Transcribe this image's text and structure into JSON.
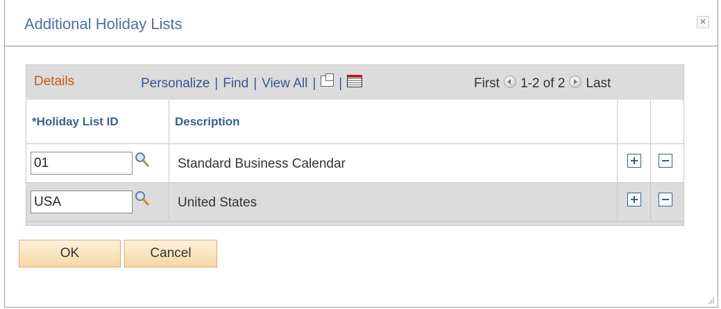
{
  "dialog": {
    "title": "Additional Holiday Lists",
    "close_glyph": "×"
  },
  "grid": {
    "title": "Details",
    "nav": {
      "personalize": "Personalize",
      "find": "Find",
      "view_all": "View All",
      "separator": "|",
      "zoom_icon": "new-window-icon",
      "download_icon": "download-icon"
    },
    "pager": {
      "first": "First",
      "range": "1-2 of 2",
      "last": "Last"
    },
    "columns": {
      "holiday_list_id": "*Holiday List ID",
      "description": "Description"
    },
    "rows": [
      {
        "holiday_list_id": "01",
        "description": "Standard Business Calendar"
      },
      {
        "holiday_list_id": "USA",
        "description": "United States"
      }
    ]
  },
  "buttons": {
    "ok": "OK",
    "cancel": "Cancel"
  }
}
